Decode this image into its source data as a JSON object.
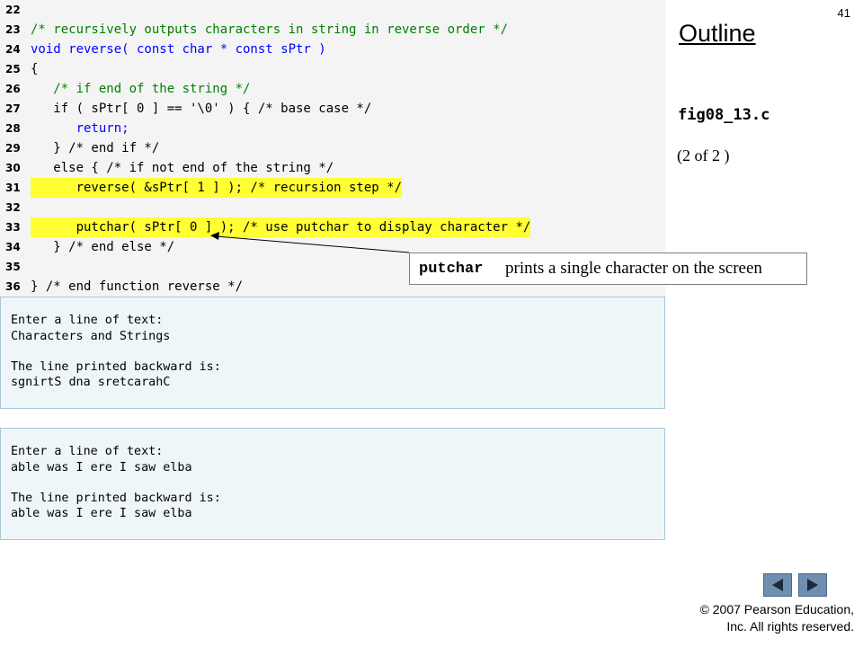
{
  "slide_number": "41",
  "outline_title": "Outline",
  "figure_name": "fig08_13.c",
  "page_indicator": "(2 of 2 )",
  "code_lines": [
    {
      "num": "22",
      "text": ""
    },
    {
      "num": "23",
      "text": "/* recursively outputs characters in string in reverse order */"
    },
    {
      "num": "24",
      "text": "void reverse( const char * const sPtr )"
    },
    {
      "num": "25",
      "text": "{"
    },
    {
      "num": "26",
      "text": "   /* if end of the string */"
    },
    {
      "num": "27",
      "text": "   if ( sPtr[ 0 ] == '\\0' ) { /* base case */"
    },
    {
      "num": "28",
      "text": "      return;"
    },
    {
      "num": "29",
      "text": "   } /* end if */"
    },
    {
      "num": "30",
      "text": "   else { /* if not end of the string */"
    },
    {
      "num": "31",
      "text": "      reverse( &sPtr[ 1 ] ); /* recursion step */"
    },
    {
      "num": "32",
      "text": ""
    },
    {
      "num": "33",
      "text": "      putchar( sPtr[ 0 ] ); /* use putchar to display character */"
    },
    {
      "num": "34",
      "text": "   } /* end else */"
    },
    {
      "num": "35",
      "text": ""
    },
    {
      "num": "36",
      "text": "} /* end function reverse */"
    }
  ],
  "outputs": [
    {
      "lines": [
        "Enter a line of text:",
        "Characters and Strings",
        "",
        "The line printed backward is:",
        "sgnirtS dna sretcarahC"
      ]
    },
    {
      "lines": [
        "Enter a line of text:",
        "able was I ere I saw elba",
        "",
        "The line printed backward is:",
        "able was I ere I saw elba"
      ]
    }
  ],
  "callout": {
    "code": "putchar",
    "text": " prints a single character on the screen"
  },
  "copyright_line1": "© 2007 Pearson Education,",
  "copyright_line2": "Inc.  All rights reserved.",
  "colors": {
    "highlight": "#ffff33",
    "comment": "#008000",
    "keyword": "#0000ff"
  },
  "navigation": {
    "prev_icon": "triangle-left-icon",
    "next_icon": "triangle-right-icon"
  }
}
